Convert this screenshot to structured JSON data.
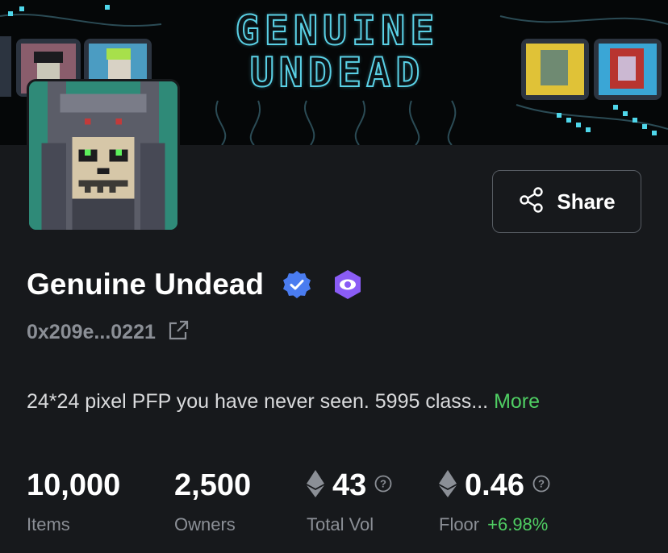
{
  "banner": {
    "title_line1": "GENUINE",
    "title_line2": "UNDEAD"
  },
  "collection": {
    "name": "Genuine Undead",
    "address": "0x209e...0221",
    "description": "24*24 pixel PFP you have never seen. 5995 class... ",
    "more_label": "More"
  },
  "share": {
    "label": "Share"
  },
  "stats": [
    {
      "value": "10,000",
      "label": "Items"
    },
    {
      "value": "2,500",
      "label": "Owners"
    },
    {
      "value": "43",
      "label": "Total Vol"
    },
    {
      "value": "0.46",
      "label": "Floor",
      "change": "+6.98%"
    }
  ],
  "colors": {
    "background": "#17191c",
    "verified_badge": "#4a7cf0",
    "watch_badge": "#8a5cf5",
    "positive": "#4fce63",
    "muted_text": "#8b8f96"
  },
  "icons": [
    "verified-badge-icon",
    "eye-badge-icon",
    "external-link-icon",
    "share-icon",
    "ethereum-icon",
    "help-icon"
  ]
}
